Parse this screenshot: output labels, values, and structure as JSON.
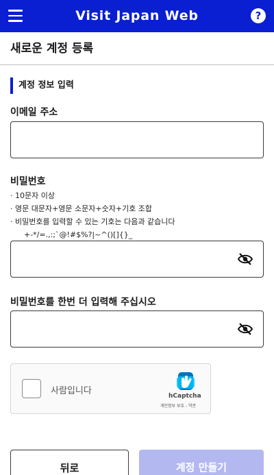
{
  "header": {
    "title": "Visit Japan Web",
    "menu_icon": "hamburger-menu-icon",
    "help_label": "?",
    "bg_color": "#0a1fd1"
  },
  "page": {
    "title": "새로운 계정 등록"
  },
  "section": {
    "title": "계정 정보 입력"
  },
  "email": {
    "label": "이메일 주소",
    "value": ""
  },
  "password": {
    "label": "비밀번호",
    "value": "",
    "hints": [
      "· 10문자 이상",
      "· 영문 대문자+영문 소문자+숫자+기호 조합",
      "· 비밀번호를 입력할 수 있는 기호는 다음과 같습니다",
      "+-*/=.,:;`@!#$%?|~^()[]{}_"
    ],
    "toggle_icon": "eye-off-icon"
  },
  "password_confirm": {
    "label": "비밀번호를 한번 더 입력해 주십시오",
    "value": "",
    "toggle_icon": "eye-off-icon"
  },
  "captcha": {
    "checkbox_label": "사람입니다",
    "brand": "hCaptcha",
    "privacy_link": "개인정보 보호",
    "separator": " - ",
    "terms_link": "약관",
    "checked": false
  },
  "buttons": {
    "back_label": "뒤로",
    "create_label": "계정 만들기",
    "create_disabled": true
  }
}
